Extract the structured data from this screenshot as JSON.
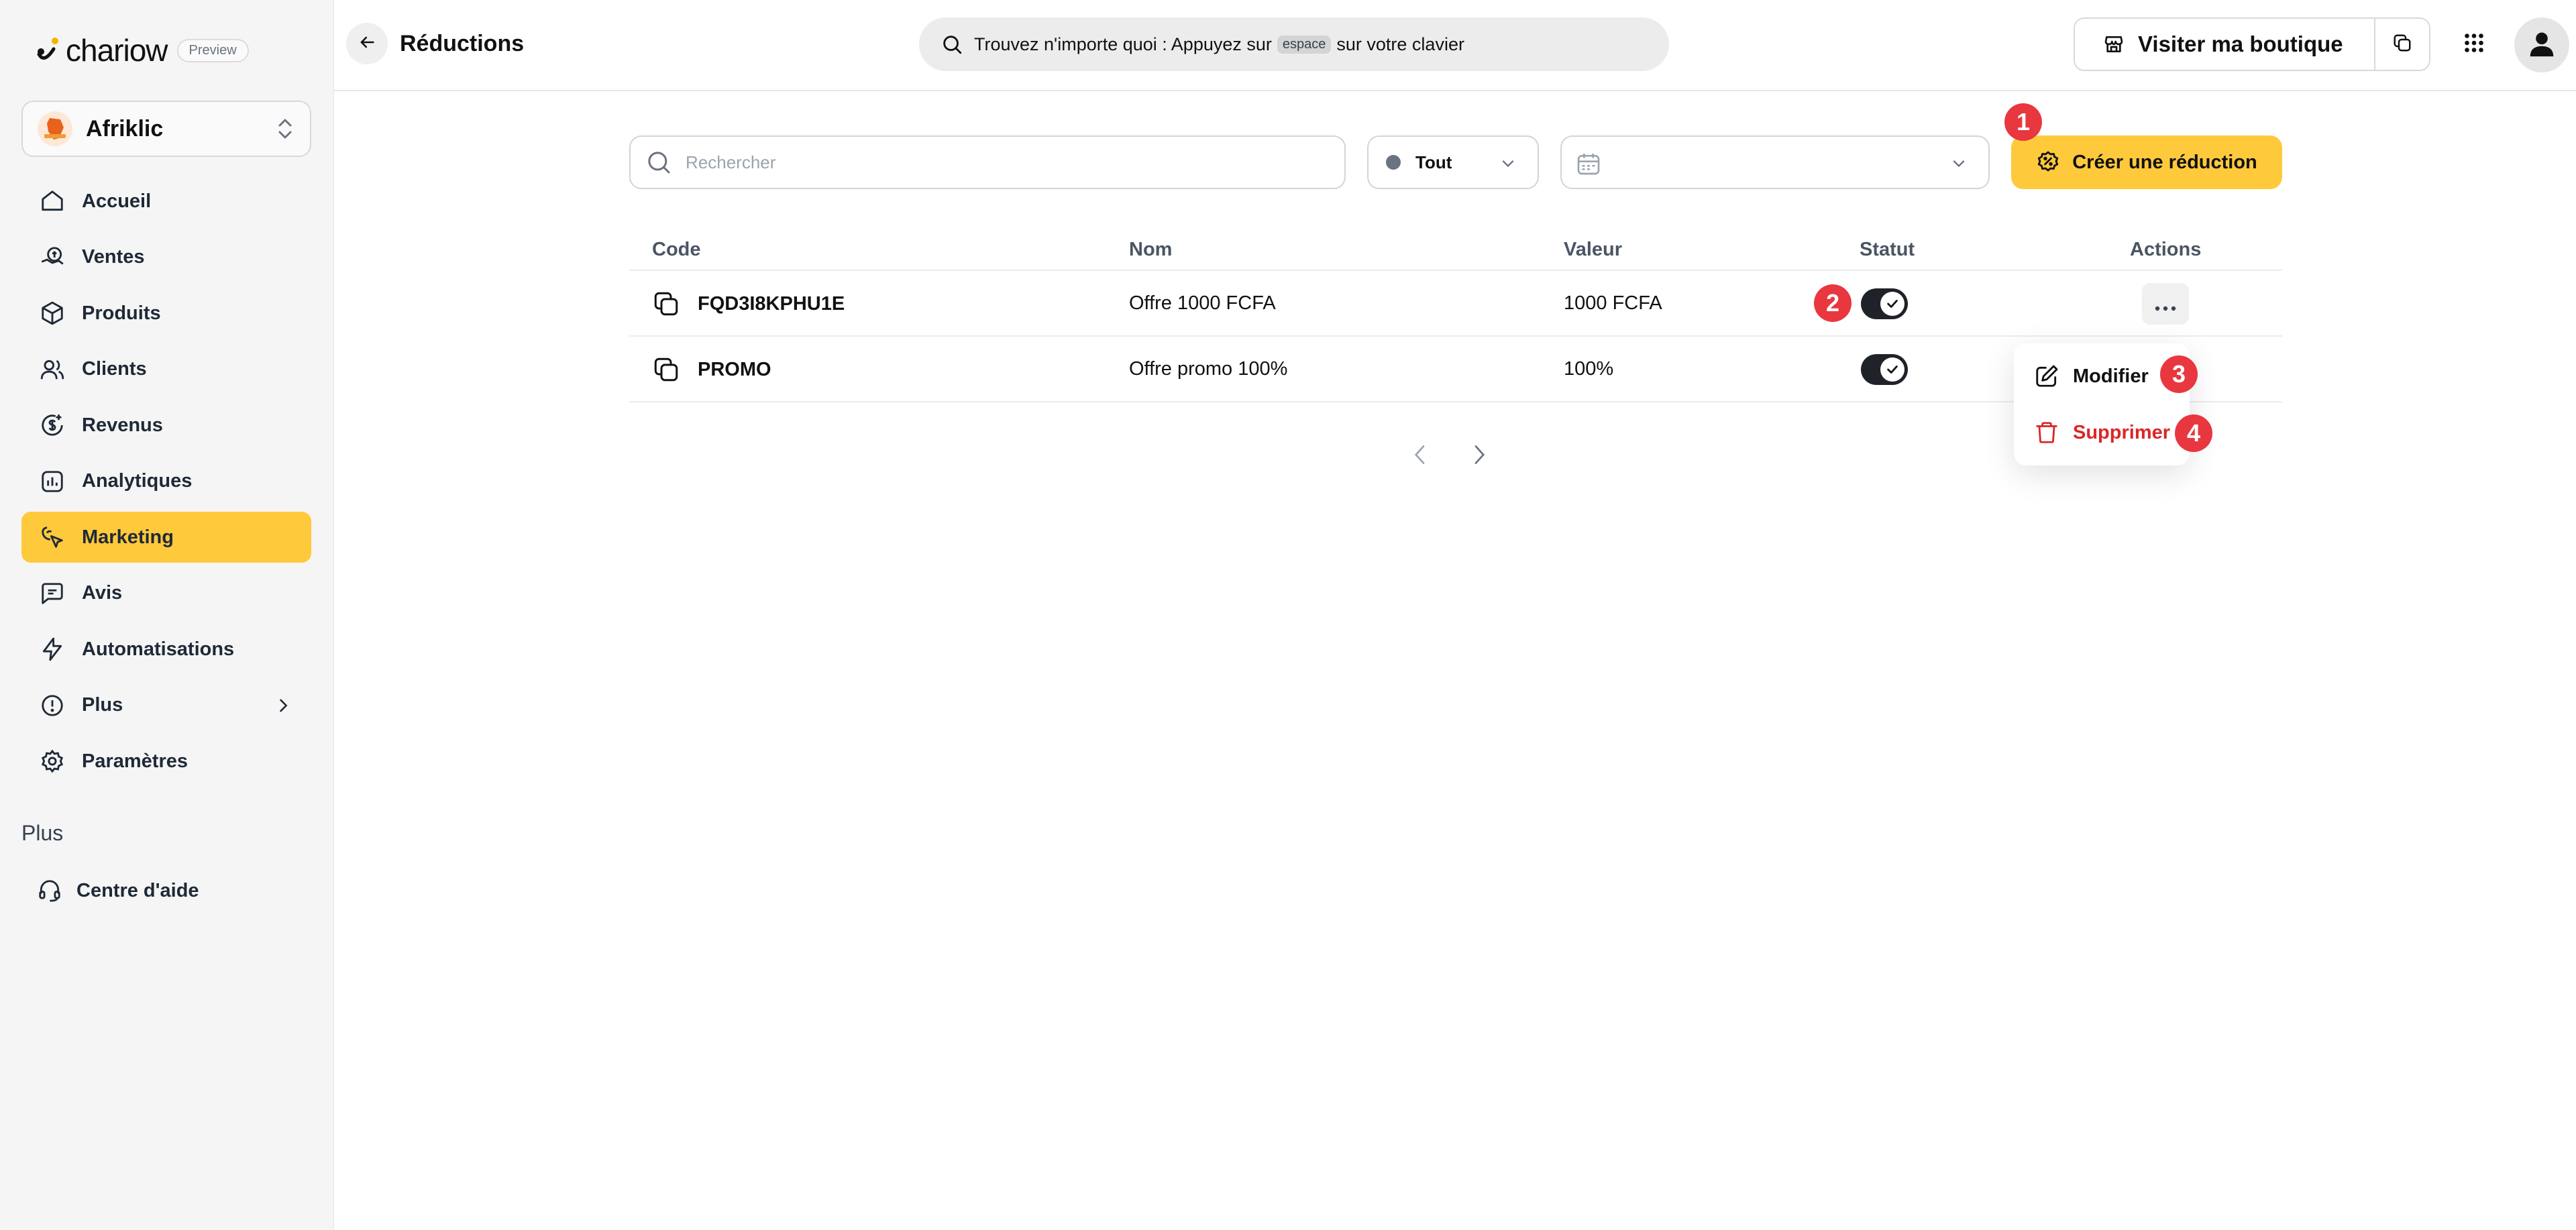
{
  "brand": {
    "logo_text": "chariow",
    "badge": "Preview"
  },
  "store": {
    "name": "Afriklic"
  },
  "sidebar": {
    "items": [
      {
        "label": "Accueil",
        "icon": "home-icon"
      },
      {
        "label": "Ventes",
        "icon": "sales-icon"
      },
      {
        "label": "Produits",
        "icon": "box-icon"
      },
      {
        "label": "Clients",
        "icon": "users-icon"
      },
      {
        "label": "Revenus",
        "icon": "revenue-icon"
      },
      {
        "label": "Analytiques",
        "icon": "chart-icon"
      },
      {
        "label": "Marketing",
        "icon": "marketing-icon",
        "active": true
      },
      {
        "label": "Avis",
        "icon": "reviews-icon"
      },
      {
        "label": "Automatisations",
        "icon": "bolt-icon"
      },
      {
        "label": "Plus",
        "icon": "info-icon",
        "has_chevron": true
      },
      {
        "label": "Paramètres",
        "icon": "gear-icon"
      }
    ],
    "section_title": "Plus",
    "help_label": "Centre d'aide"
  },
  "topbar": {
    "title": "Réductions",
    "search_prefix": "Trouvez n'importe quoi : Appuyez sur",
    "search_key": "espace",
    "search_suffix": "sur votre clavier",
    "visit_label": "Visiter ma boutique"
  },
  "filters": {
    "search_placeholder": "Rechercher",
    "status_value": "Tout",
    "create_label": "Créer une réduction"
  },
  "table": {
    "headers": {
      "code": "Code",
      "name": "Nom",
      "value": "Valeur",
      "status": "Statut",
      "actions": "Actions"
    },
    "rows": [
      {
        "code": "FQD3I8KPHU1E",
        "name": "Offre 1000 FCFA",
        "value": "1000 FCFA",
        "active": true
      },
      {
        "code": "PROMO",
        "name": "Offre promo 100%",
        "value": "100%",
        "active": true
      }
    ]
  },
  "menu": {
    "edit_label": "Modifier",
    "delete_label": "Supprimer"
  },
  "annotations": [
    "1",
    "2",
    "3",
    "4"
  ],
  "colors": {
    "accent": "#ffc93c",
    "badge": "#e8373f",
    "danger": "#dc2626",
    "toggle_on": "#1f2329"
  }
}
